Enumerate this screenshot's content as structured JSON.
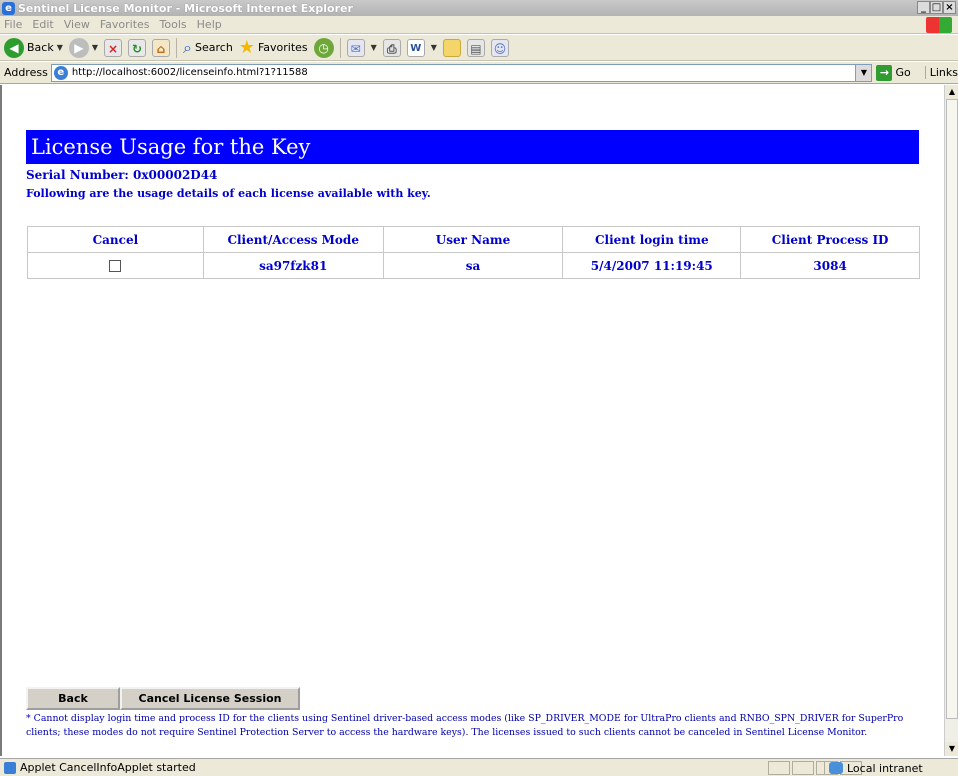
{
  "window": {
    "title": "Sentinel License Monitor - Microsoft Internet Explorer",
    "controls": [
      "_",
      "□",
      "×"
    ]
  },
  "menu": [
    "File",
    "Edit",
    "View",
    "Favorites",
    "Tools",
    "Help"
  ],
  "toolbar": {
    "back_label": "Back",
    "search_label": "Search",
    "favorites_label": "Favorites"
  },
  "address": {
    "label": "Address",
    "url": "http://localhost:6002/licenseinfo.html?1?11588",
    "go_label": "Go",
    "links_label": "Links"
  },
  "page": {
    "title": "License Usage for the Key",
    "serial": "Serial Number: 0x00002D44",
    "subtitle": "Following are the usage details of each license available with key.",
    "table": {
      "headers": [
        "Cancel",
        "Client/Access Mode",
        "User Name",
        "Client login time",
        "Client Process ID"
      ],
      "rows": [
        {
          "client": "sa97fzk81",
          "user": "sa",
          "login_time": "5/4/2007 11:19:45",
          "pid": "3084"
        }
      ]
    },
    "buttons": {
      "back": "Back",
      "cancel_session": "Cancel License Session"
    },
    "footnote": "* Cannot display login time and process ID for the clients using Sentinel driver-based access modes (like SP_DRIVER_MODE for UltraPro clients and RNBO_SPN_DRIVER for SuperPro clients; these modes do not require Sentinel Protection Server to access the hardware keys). The licenses issued to such clients cannot be canceled in Sentinel License Monitor."
  },
  "status": {
    "text": "Applet CancelInfoApplet started",
    "zone": "Local intranet"
  }
}
